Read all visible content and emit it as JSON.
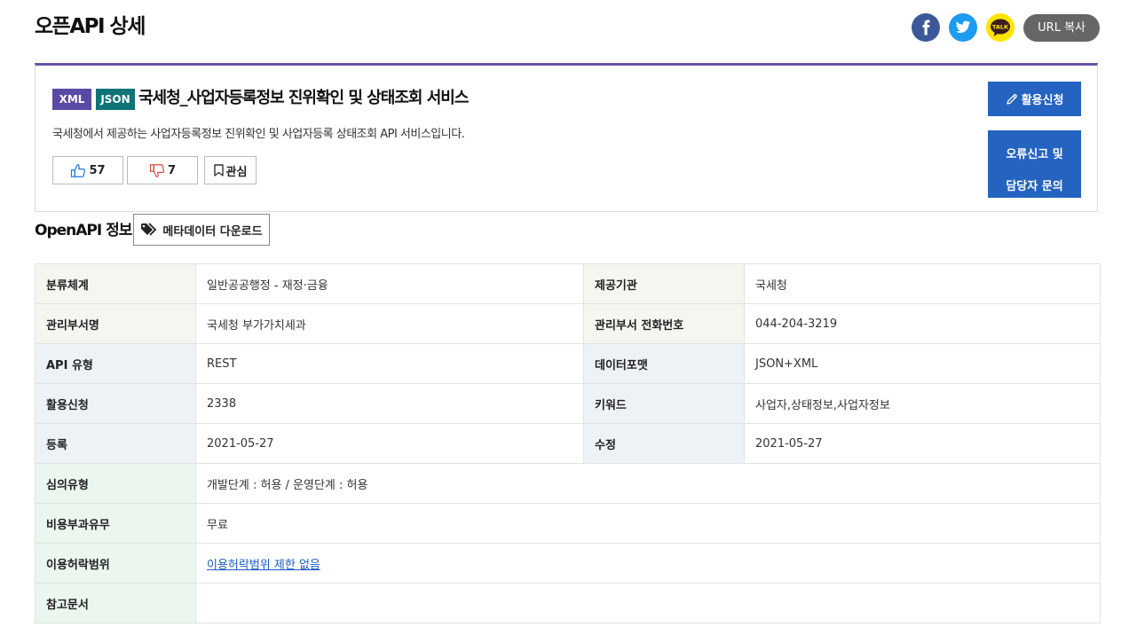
{
  "page": {
    "title": "오픈API 상세"
  },
  "share": {
    "url_copy_label": "URL 복사",
    "kakao_text": "TALK"
  },
  "api": {
    "tags": [
      "XML",
      "JSON"
    ],
    "name": "국세청_사업자등록정보 진위확인 및 상태조회 서비스",
    "description": "국세청에서 제공하는 사업자등록정보 진위확인 및 사업자등록 상태조회 API 서비스입니다.",
    "likes": "57",
    "dislikes": "7",
    "favorite_label": "관심",
    "apply_label": "활용신청",
    "report_label_line1": "오류신고 및",
    "report_label_line2": "담당자 문의"
  },
  "section": {
    "title": "OpenAPI 정보",
    "metadata_download_label": "메타데이터 다운로드"
  },
  "info": {
    "rows": [
      {
        "label": "분류체계",
        "value": "일반공공행정 - 재정·금융",
        "label2": "제공기관",
        "value2": "국세청"
      },
      {
        "label": "관리부서명",
        "value": "국세청 부가가치세과",
        "label2": "관리부서 전화번호",
        "value2": "044-204-3219"
      },
      {
        "label": "API 유형",
        "value": "REST",
        "label2": "데이터포맷",
        "value2": "JSON+XML"
      },
      {
        "label": "활용신청",
        "value": "2338",
        "label2": "키워드",
        "value2": "사업자,상태정보,사업자정보"
      },
      {
        "label": "등록",
        "value": "2021-05-27",
        "label2": "수정",
        "value2": "2021-05-27"
      },
      {
        "label": "심의유형",
        "value": "개발단계 : 허용 / 운영단계 : 허용"
      },
      {
        "label": "비용부과유무",
        "value": "무료"
      },
      {
        "label": "이용허락범위",
        "value": "이용허락범위 제한 없음"
      },
      {
        "label": "참고문서",
        "value": ""
      }
    ]
  },
  "colors": {
    "accent_purple": "#6a53a6",
    "xml_tag": "#5a4aa5",
    "json_tag": "#0e7477",
    "primary_blue": "#2563c1",
    "facebook": "#3b5998",
    "twitter": "#1d9bf0",
    "kakao": "#ffe500"
  }
}
